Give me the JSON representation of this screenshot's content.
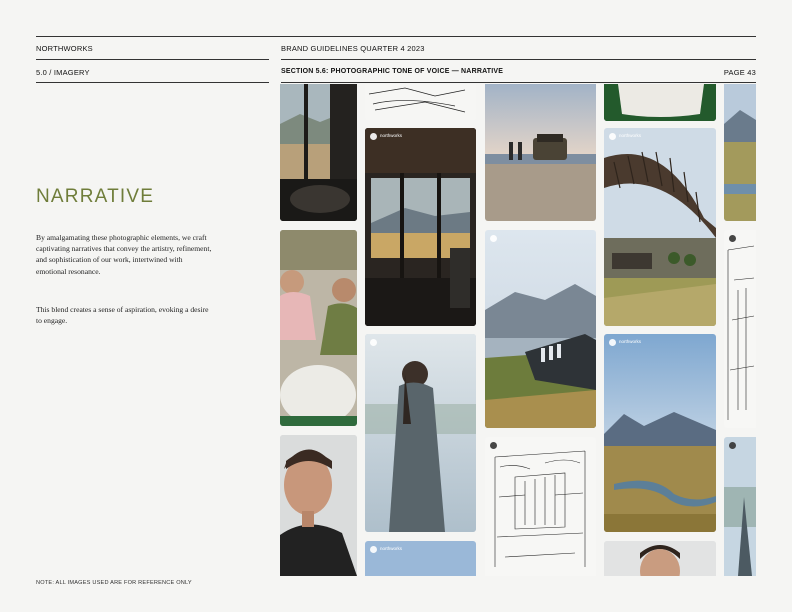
{
  "header": {
    "brand": "NORTHWORKS",
    "doc_title": "BRAND GUIDELINES QUARTER 4 2023",
    "chapter": "5.0 / IMAGERY",
    "section": "SECTION 5.6: PHOTOGRAPHIC TONE OF VOICE — NARRATIVE",
    "page": "PAGE 43"
  },
  "content": {
    "title": "NARRATIVE",
    "paragraph1": "By amalgamating these photographic elements, we craft captivating narratives that convey the artistry, refinement, and sophistication of our work, intertwined with emotional resonance.",
    "paragraph2": "This blend creates a sense of aspiration, evoking a desire to engage."
  },
  "footnote": "NOTE: ALL IMAGES USED ARE FOR REFERENCE ONLY",
  "gallery": {
    "handle": "northworks",
    "images": [
      {
        "subject": "interior-window-mountains-image"
      },
      {
        "subject": "architectural-sketch-image"
      },
      {
        "subject": "couple-beach-truck-image"
      },
      {
        "subject": "tablecloth-grass-image"
      },
      {
        "subject": "mountain-lake-edge-image"
      },
      {
        "subject": "cabin-interior-lake-view-image"
      },
      {
        "subject": "curved-timber-pavilion-image"
      },
      {
        "subject": "lake-landscape-image"
      },
      {
        "subject": "two-men-meeting-image"
      },
      {
        "subject": "mountain-sunset-image"
      },
      {
        "subject": "interior-sketch-image"
      },
      {
        "subject": "woman-misty-lake-image"
      },
      {
        "subject": "lodge-green-roof-hill-image"
      },
      {
        "subject": "smiling-man-portrait-image"
      },
      {
        "subject": "cafe-sketch-image"
      },
      {
        "subject": "mountain-river-valley-image"
      },
      {
        "subject": "misty-lake-partial-image"
      },
      {
        "subject": "blue-sky-tile-image"
      },
      {
        "subject": "portrait-man-partial-image"
      }
    ]
  }
}
